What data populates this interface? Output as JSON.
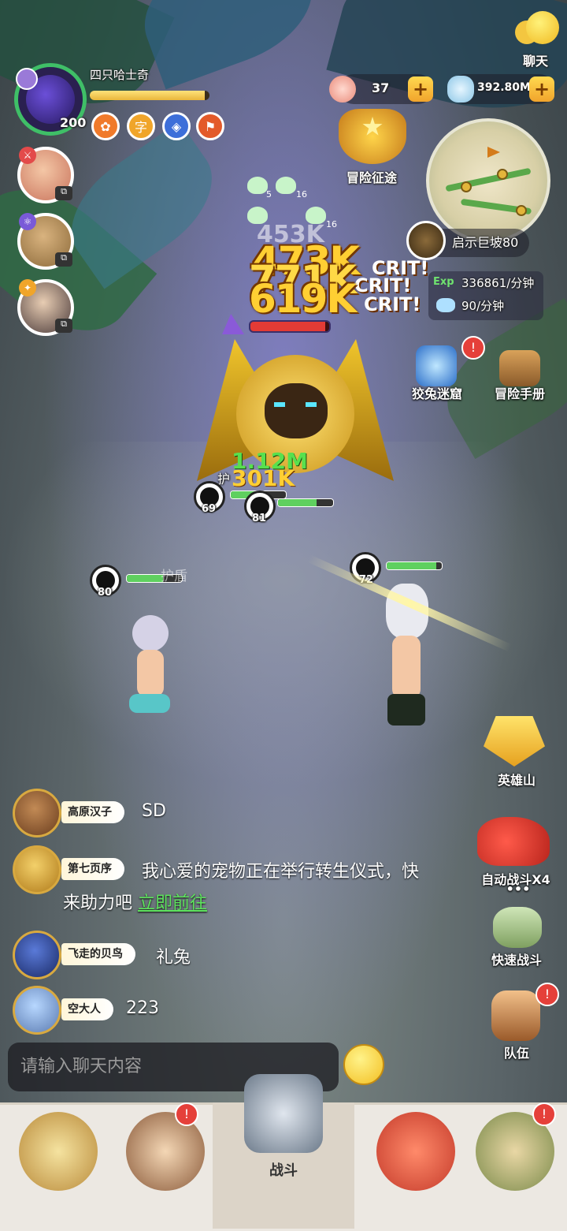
{
  "top_right": {
    "chat_label": "聊天"
  },
  "player": {
    "name": "四只哈士奇",
    "level": "200",
    "hp_fraction": 0.96
  },
  "buffs": [
    "✿",
    "字",
    "◈",
    "⚑"
  ],
  "currency": {
    "shells": "37",
    "gems": "392.80M"
  },
  "adventure_journey": "冒险征途",
  "stage": {
    "name": "启示巨坡80",
    "exp_label": "Exp",
    "exp_rate": "336861/分钟",
    "gem_rate": "90/分钟"
  },
  "shortcuts": {
    "maze": "狡兔迷窟",
    "handbook": "冒险手册",
    "hero_mountain": "英雄山",
    "auto_battle": "自动战斗X4",
    "more": "•••",
    "quick_battle": "快速战斗",
    "team": "队伍"
  },
  "damage": {
    "line1": "473K",
    "line2": "771K",
    "line3": "619K",
    "ghost": "453K",
    "crit": "CRIT!",
    "lower1": "1.12M",
    "lower2": "301K",
    "shield_text": "护盾",
    "guard": "护"
  },
  "skulls": [
    "5",
    "16",
    "16"
  ],
  "units": [
    {
      "level": "69",
      "hp": 0.5
    },
    {
      "level": "81",
      "hp": 0.7
    },
    {
      "level": "80",
      "hp": 0.65
    },
    {
      "level": "72",
      "hp": 0.9
    }
  ],
  "boss": {
    "hp_fraction": 0.95
  },
  "chat": {
    "messages": [
      {
        "name": "高原汉子",
        "text": "SD"
      },
      {
        "name": "第七页序",
        "text": "我心爱的宠物正在举行转生仪式，快来助力吧",
        "link": "立即前往"
      },
      {
        "name": "飞走的贝鸟",
        "text": "礼兔"
      },
      {
        "name": "空大人",
        "text": "223"
      }
    ],
    "placeholder": "请输入聊天内容"
  },
  "nav": {
    "battle_label": "战斗"
  },
  "colors": {
    "accent": "#f1a42c",
    "chat_link": "#5ee35e",
    "notify": "#e5403a"
  }
}
